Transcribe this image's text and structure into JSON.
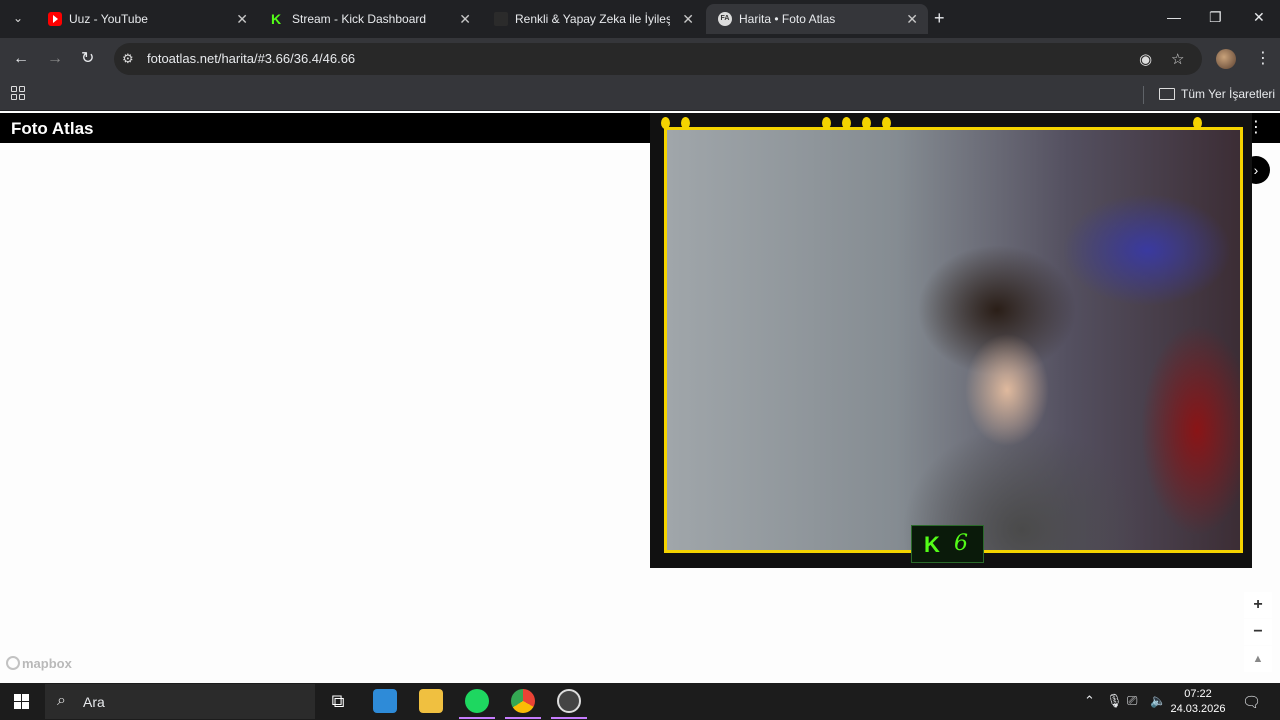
{
  "browser": {
    "tabs": [
      {
        "title": "Uuz - YouTube",
        "favicon": "youtube-icon",
        "active": false
      },
      {
        "title": "Stream - Kick Dashboard",
        "favicon": "kick-icon",
        "active": false
      },
      {
        "title": "Renkli & Yapay Zeka ile İyileştir",
        "favicon": "generic-icon",
        "active": false
      },
      {
        "title": "Harita • Foto Atlas",
        "favicon": "fotoatlas-icon",
        "active": true
      }
    ],
    "url": "fotoatlas.net/harita/#3.66/36.4/46.66",
    "bookmarks_label": "Tüm Yer İşaretleri"
  },
  "page": {
    "brand": "Foto Atlas",
    "map_attribution": "mapbox",
    "zoom_in": "+",
    "zoom_out": "−",
    "reset_north": "▲"
  },
  "overlay": {
    "kick_letter": "K",
    "viewer_count": "6"
  },
  "taskbar": {
    "search_placeholder": "Ara",
    "time": "07:22",
    "date": "24.03.2026"
  },
  "colors": {
    "kick_green": "#53fc18",
    "frame_yellow": "#f5d400",
    "chrome_dark": "#202124",
    "chrome_toolbar": "#35363a"
  }
}
